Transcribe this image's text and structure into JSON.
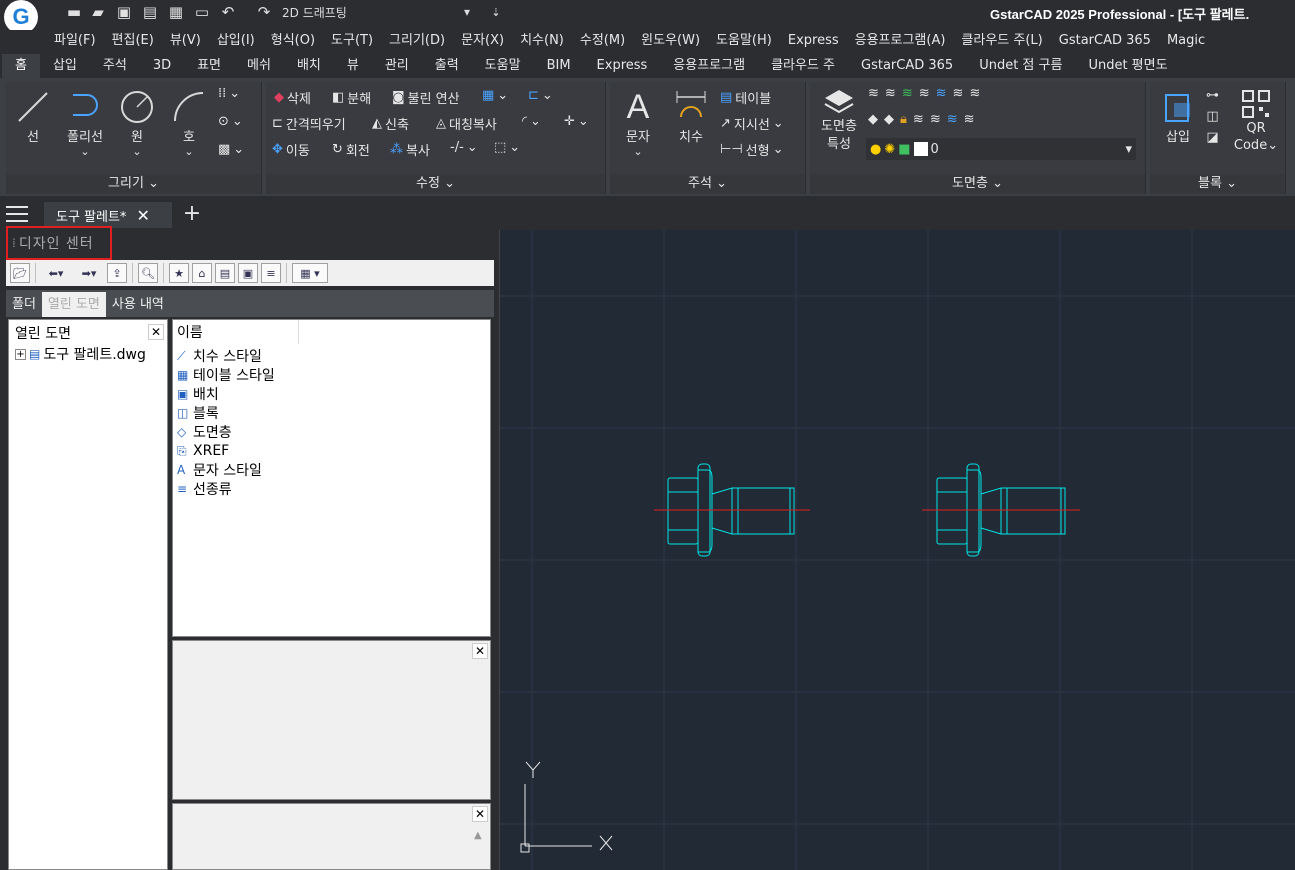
{
  "app": {
    "title": "GstarCAD 2025 Professional - [도구 팔레트.",
    "logo": "G",
    "workspace": "2D 드래프팅"
  },
  "menus": [
    "파일(F)",
    "편집(E)",
    "뷰(V)",
    "삽입(I)",
    "형식(O)",
    "도구(T)",
    "그리기(D)",
    "문자(X)",
    "치수(N)",
    "수정(M)",
    "윈도우(W)",
    "도움말(H)",
    "Express",
    "응용프로그램(A)",
    "클라우드 주(L)",
    "GstarCAD 365",
    "Magic"
  ],
  "ribbon_tabs": [
    "홈",
    "삽입",
    "주석",
    "3D",
    "표면",
    "메쉬",
    "배치",
    "뷰",
    "관리",
    "출력",
    "도움말",
    "BIM",
    "Express",
    "응용프로그램",
    "클라우드 주",
    "GstarCAD 365",
    "Undet 점 구름",
    "Undet 평면도"
  ],
  "ribbon": {
    "draw": {
      "line": "선",
      "polyline": "폴리선",
      "circle": "원",
      "arc": "호",
      "title": "그리기"
    },
    "modify": {
      "erase": "삭제",
      "explode": "분해",
      "boolean": "불린 연산",
      "offset": "간격띄우기",
      "stretch": "신축",
      "mirror": "대칭복사",
      "move": "이동",
      "rotate": "회전",
      "copy": "복사",
      "title": "수정"
    },
    "annotation": {
      "text": "문자",
      "dim": "치수",
      "table": "테이블",
      "leader": "지시선",
      "linear": "선형",
      "title": "주석"
    },
    "layers": {
      "props_line1": "도면층",
      "props_line2": "특성",
      "current": "0",
      "title": "도면층"
    },
    "block": {
      "insert": "삽입",
      "qr_line1": "QR",
      "qr_line2": "Code",
      "title": "블록"
    }
  },
  "doc_tab": {
    "name": "도구 팔레트*"
  },
  "design_center": {
    "title": "디자인 센터",
    "tabs": [
      "폴더",
      "열린 도면",
      "사용 내역"
    ],
    "tree": {
      "header": "열린 도면",
      "file": "도구 팔레트.dwg"
    },
    "list_header": "이름",
    "items": [
      "치수 스타일",
      "테이블 스타일",
      "배치",
      "블록",
      "도면층",
      "XREF",
      "문자 스타일",
      "선종류"
    ]
  },
  "ucs": {
    "x": "X",
    "y": "Y"
  },
  "colors": {
    "bg": "#2b2d31",
    "ribbon": "#3c3f44",
    "canvas": "#222a36",
    "drawing": "#00e5e5",
    "centerline": "#e02020",
    "highlight": "#e02020"
  }
}
